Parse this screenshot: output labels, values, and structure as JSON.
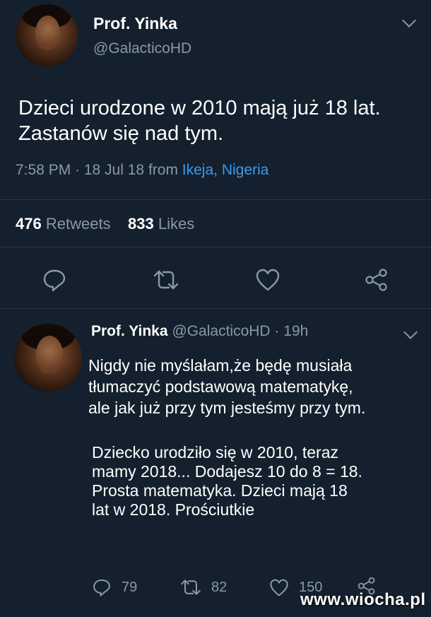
{
  "tweet": {
    "name": "Prof. Yinka",
    "handle": "@GalacticoHD",
    "text_line1": "Dzieci urodzone w 2010 mają już 18 lat.",
    "text_line2": "Zastanów się nad tym.",
    "time_date": "7:58 PM · 18 Jul 18",
    "from": "from",
    "location": "Ikeja, Nigeria",
    "retweets_count": "476",
    "retweets_label": "Retweets",
    "likes_count": "833",
    "likes_label": "Likes"
  },
  "reply": {
    "name": "Prof. Yinka",
    "handle_time": "@GalacticoHD · 19h",
    "para1_line1": "Nigdy nie myślałam,że będę musiała",
    "para1_line2": "tłumaczyć podstawową matematykę,",
    "para1_line3": "ale jak już przy tym jesteśmy przy tym.",
    "para2_line1": "Dziecko urodziło się w 2010, teraz",
    "para2_line2": "mamy 2018... Dodajesz 10 do 8 = 18.",
    "para2_line3": "Prosta matematyka. Dzieci mają 18",
    "para2_line4": "lat w 2018. Prościutkie",
    "replies": "79",
    "retweets": "82",
    "likes": "150"
  },
  "watermark": "www.wiocha.pl",
  "icons": [
    "comment-icon",
    "retweet-icon",
    "heart-icon",
    "share-icon",
    "chevron-down-icon"
  ],
  "colors": {
    "background": "#14202d",
    "muted": "#8899a6",
    "link": "#3b9bf0"
  }
}
